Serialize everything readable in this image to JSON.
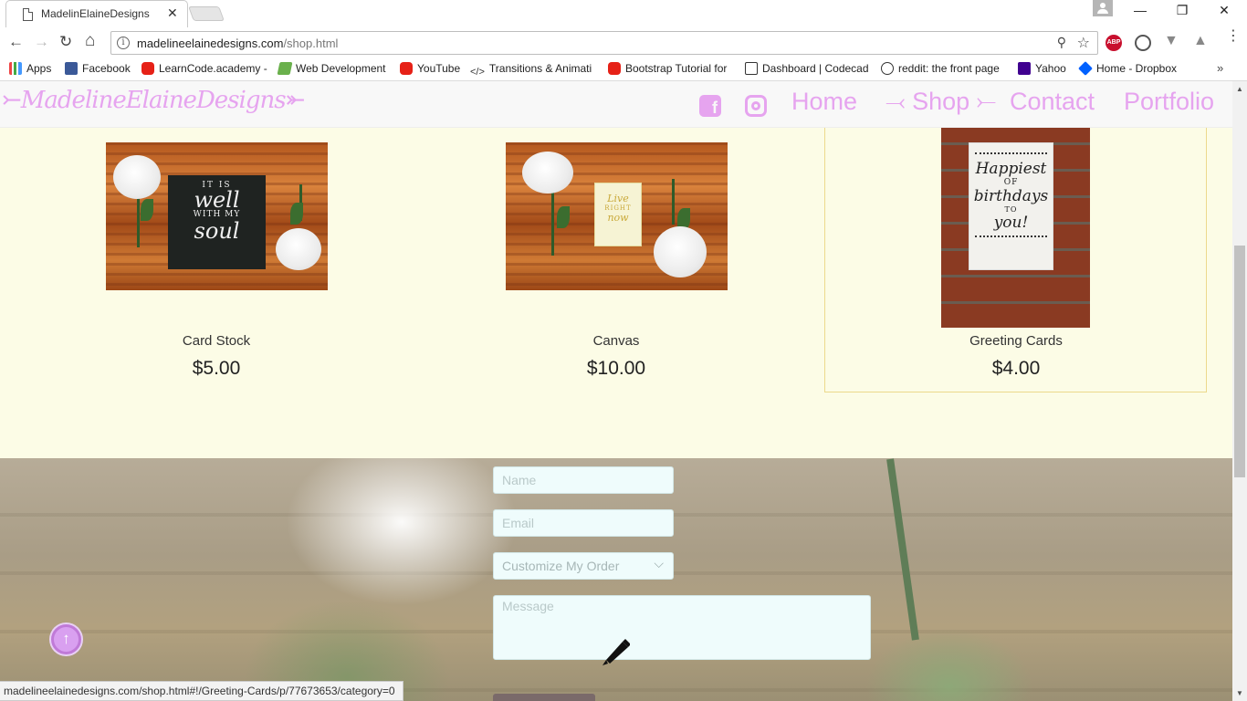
{
  "browser": {
    "tab_title": "MadelinElaineDesigns",
    "tab_close": "✕",
    "url_host": "madelineelainedesigns.com",
    "url_path": "/shop.html",
    "info_icon": "i",
    "window_controls": {
      "minimize": "—",
      "restore": "❐",
      "close": "✕"
    },
    "nav": {
      "back": "←",
      "forward": "→",
      "reload": "↻",
      "home": "⌂"
    },
    "zoom_icon": "⚲",
    "star_icon": "☆",
    "ext_abp": "ABP",
    "ext_v": "▼",
    "ext_drive": "▲",
    "menu_dots": "⋮",
    "bookmarks": [
      {
        "label": "Apps",
        "icon": "apps-icon"
      },
      {
        "label": "Facebook",
        "icon": "facebook-icon"
      },
      {
        "label": "LearnCode.academy -",
        "icon": "youtube-icon"
      },
      {
        "label": "Web Development",
        "icon": "web-dev-icon"
      },
      {
        "label": "YouTube",
        "icon": "youtube-icon"
      },
      {
        "label": "Transitions & Animati",
        "icon": "code-icon"
      },
      {
        "label": "Bootstrap Tutorial for",
        "icon": "youtube-icon"
      },
      {
        "label": "Dashboard | Codecad",
        "icon": "codecademy-icon"
      },
      {
        "label": "reddit: the front page",
        "icon": "reddit-icon"
      },
      {
        "label": "Yahoo",
        "icon": "yahoo-icon"
      },
      {
        "label": "Home - Dropbox",
        "icon": "dropbox-icon"
      }
    ],
    "bookmarks_more": "»",
    "status_url": "madelineelainedesigns.com/shop.html#!/Greeting-Cards/p/77673653/category=0"
  },
  "site": {
    "logo": "⤚MadelineElaineDesigns⤜",
    "nav": {
      "home": "Home",
      "shop": "⤙ Shop ⤚",
      "contact": "Contact",
      "portfolio": "Portfolio"
    },
    "social": {
      "facebook": "f"
    },
    "accent_color": "#e6a4ef"
  },
  "products": [
    {
      "name": "Card Stock",
      "price": "$5.00",
      "art_text": [
        "IT IS",
        "well",
        "WITH MY",
        "soul"
      ]
    },
    {
      "name": "Canvas",
      "price": "$10.00",
      "art_text": [
        "Live",
        "RIGHT",
        "now"
      ]
    },
    {
      "name": "Greeting Cards",
      "price": "$4.00",
      "art_text": [
        "Happiest",
        "OF",
        "birthdays",
        "TO",
        "you!"
      ]
    }
  ],
  "contact_form": {
    "name_placeholder": "Name",
    "email_placeholder": "Email",
    "order_select": "Customize My Order",
    "message_placeholder": "Message"
  },
  "scroll": {
    "up": "▲",
    "down": "▼"
  }
}
